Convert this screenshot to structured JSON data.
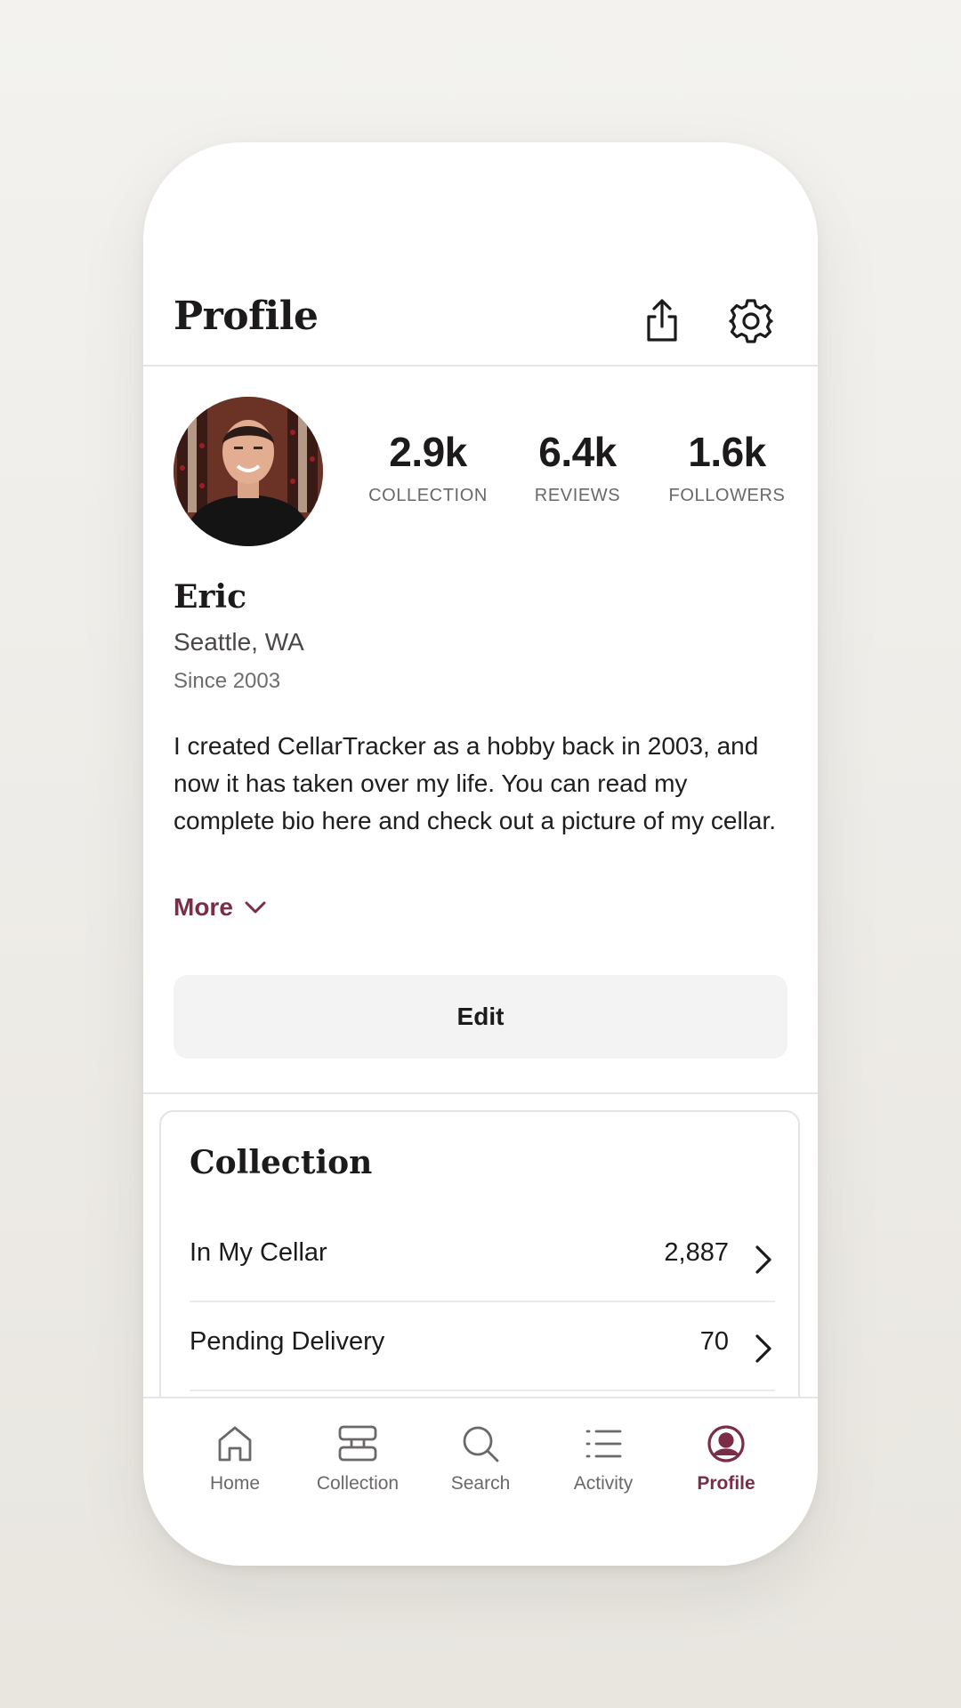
{
  "header": {
    "title": "Profile",
    "share_icon": "share-icon",
    "settings_icon": "gear-icon"
  },
  "profile": {
    "stats": [
      {
        "value": "2.9k",
        "label": "COLLECTION"
      },
      {
        "value": "6.4k",
        "label": "REVIEWS"
      },
      {
        "value": "1.6k",
        "label": "FOLLOWERS"
      }
    ],
    "name": "Eric",
    "location": "Seattle, WA",
    "since": "Since 2003",
    "bio": "I created CellarTracker as a hobby back in 2003, and now it has taken over my life. You can read my complete bio here and check out a picture of my cellar.",
    "more_label": "More",
    "edit_label": "Edit"
  },
  "collection": {
    "title": "Collection",
    "rows": [
      {
        "label": "In My Cellar",
        "count": "2,887"
      },
      {
        "label": "Pending Delivery",
        "count": "70"
      }
    ]
  },
  "tabs": [
    {
      "label": "Home",
      "icon": "home-icon"
    },
    {
      "label": "Collection",
      "icon": "collection-icon"
    },
    {
      "label": "Search",
      "icon": "search-icon"
    },
    {
      "label": "Activity",
      "icon": "activity-icon"
    },
    {
      "label": "Profile",
      "icon": "profile-icon",
      "active": true
    }
  ],
  "colors": {
    "accent": "#7a2d44",
    "muted": "#6b6867",
    "button_bg": "#f3f3f3"
  }
}
